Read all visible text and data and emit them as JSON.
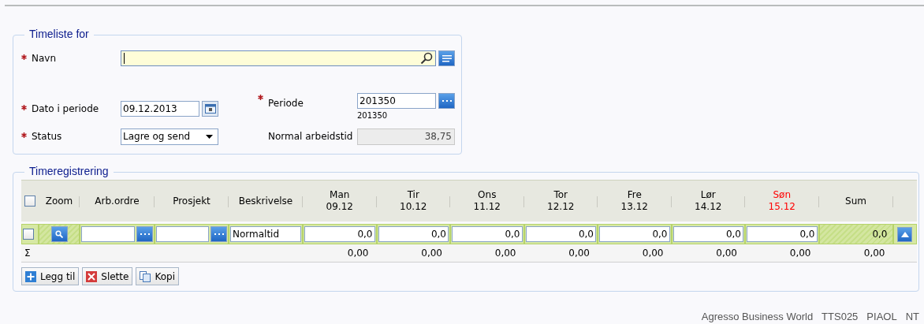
{
  "header_panel": {
    "title": "Timeliste for",
    "fields": [
      {
        "kind": "lookup",
        "label": "Navn",
        "required": true,
        "focused": true
      },
      {
        "kind": "date",
        "label": "Dato i periode",
        "required": true,
        "value": "09.12.2013"
      },
      {
        "kind": "select",
        "label": "Status",
        "required": true,
        "value": "Lagre og send"
      },
      {
        "kind": "picker",
        "label": "Periode",
        "required": true,
        "value": "201350",
        "note": "201350"
      },
      {
        "kind": "readonly",
        "label": "Normal arbeidstid",
        "required": false,
        "value": "38,75"
      }
    ]
  },
  "registration": {
    "title": "Timeregistrering",
    "select_all": {
      "checked": false
    },
    "columns": [
      {
        "label": "Zoom"
      },
      {
        "label": "Arb.ordre"
      },
      {
        "label": "Prosjekt"
      },
      {
        "label": "Beskrivelse"
      },
      {
        "label": "Man",
        "date": "09.12",
        "color": "#000000"
      },
      {
        "label": "Tir",
        "date": "10.12",
        "color": "#000000"
      },
      {
        "label": "Ons",
        "date": "11.12",
        "color": "#000000"
      },
      {
        "label": "Tor",
        "date": "12.12",
        "color": "#000000"
      },
      {
        "label": "Fre",
        "date": "13.12",
        "color": "#000000"
      },
      {
        "label": "Lør",
        "date": "14.12",
        "color": "#000000"
      },
      {
        "label": "Søn",
        "date": "15.12",
        "color": "#ff0000"
      },
      {
        "label": "Sum"
      }
    ],
    "rows": [
      {
        "checked": false,
        "description": "Normaltid",
        "hours": [
          "0,0",
          "0,0",
          "0,0",
          "0,0",
          "0,0",
          "0,0",
          "0,0"
        ],
        "sum": "0,0"
      }
    ],
    "totals": {
      "symbol": "Σ",
      "values": [
        "0,00",
        "0,00",
        "0,00",
        "0,00",
        "0,00",
        "0,00",
        "0,00"
      ],
      "sum": "0,00"
    },
    "buttons": [
      {
        "kind": "add",
        "label": "Legg til"
      },
      {
        "kind": "delete",
        "label": "Slette"
      },
      {
        "kind": "copy",
        "label": "Kopi"
      }
    ]
  },
  "status_bar": [
    "Agresso Business World",
    "TTS025",
    "PIAOL",
    "NT"
  ]
}
